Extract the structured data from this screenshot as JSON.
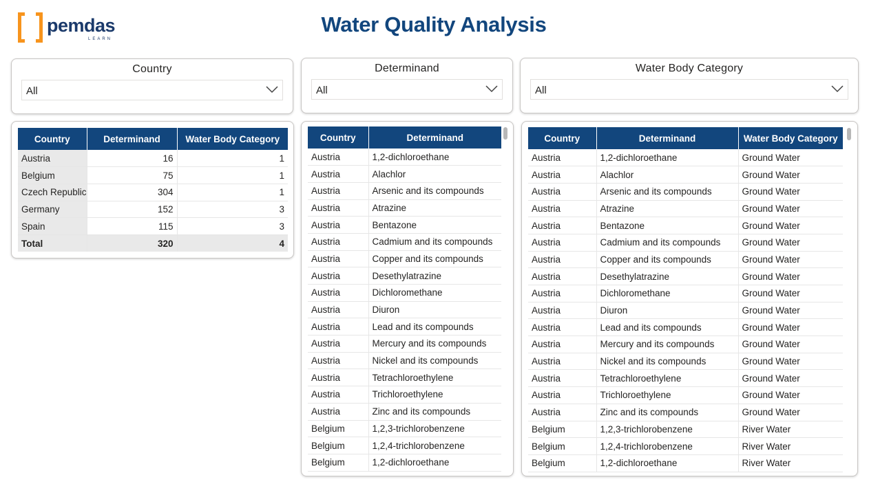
{
  "logo": {
    "word": "pemdas",
    "sub": "LEARN"
  },
  "title": "Water Quality Analysis",
  "slicers": {
    "country": {
      "title": "Country",
      "value": "All"
    },
    "determinand": {
      "title": "Determinand",
      "value": "All"
    },
    "water_body": {
      "title": "Water Body Category",
      "value": "All"
    }
  },
  "summary_table": {
    "headers": [
      "Country",
      "Determinand",
      "Water Body Category"
    ],
    "rows": [
      [
        "Austria",
        "16",
        "1"
      ],
      [
        "Belgium",
        "75",
        "1"
      ],
      [
        "Czech Republic",
        "304",
        "1"
      ],
      [
        "Germany",
        "152",
        "3"
      ],
      [
        "Spain",
        "115",
        "3"
      ]
    ],
    "total": [
      "Total",
      "320",
      "4"
    ]
  },
  "determinand_table": {
    "headers": [
      "Country",
      "Determinand"
    ],
    "rows": [
      [
        "Austria",
        "1,2-dichloroethane"
      ],
      [
        "Austria",
        "Alachlor"
      ],
      [
        "Austria",
        "Arsenic and its compounds"
      ],
      [
        "Austria",
        "Atrazine"
      ],
      [
        "Austria",
        "Bentazone"
      ],
      [
        "Austria",
        "Cadmium and its compounds"
      ],
      [
        "Austria",
        "Copper and its compounds"
      ],
      [
        "Austria",
        "Desethylatrazine"
      ],
      [
        "Austria",
        "Dichloromethane"
      ],
      [
        "Austria",
        "Diuron"
      ],
      [
        "Austria",
        "Lead and its compounds"
      ],
      [
        "Austria",
        "Mercury and its compounds"
      ],
      [
        "Austria",
        "Nickel and its compounds"
      ],
      [
        "Austria",
        "Tetrachloroethylene"
      ],
      [
        "Austria",
        "Trichloroethylene"
      ],
      [
        "Austria",
        "Zinc and its compounds"
      ],
      [
        "Belgium",
        "1,2,3-trichlorobenzene"
      ],
      [
        "Belgium",
        "1,2,4-trichlorobenzene"
      ],
      [
        "Belgium",
        "1,2-dichloroethane"
      ]
    ]
  },
  "detail_table": {
    "headers": [
      "Country",
      "Determinand",
      "Water Body Category"
    ],
    "rows": [
      [
        "Austria",
        "1,2-dichloroethane",
        "Ground Water"
      ],
      [
        "Austria",
        "Alachlor",
        "Ground Water"
      ],
      [
        "Austria",
        "Arsenic and its compounds",
        "Ground Water"
      ],
      [
        "Austria",
        "Atrazine",
        "Ground Water"
      ],
      [
        "Austria",
        "Bentazone",
        "Ground Water"
      ],
      [
        "Austria",
        "Cadmium and its compounds",
        "Ground Water"
      ],
      [
        "Austria",
        "Copper and its compounds",
        "Ground Water"
      ],
      [
        "Austria",
        "Desethylatrazine",
        "Ground Water"
      ],
      [
        "Austria",
        "Dichloromethane",
        "Ground Water"
      ],
      [
        "Austria",
        "Diuron",
        "Ground Water"
      ],
      [
        "Austria",
        "Lead and its compounds",
        "Ground Water"
      ],
      [
        "Austria",
        "Mercury and its compounds",
        "Ground Water"
      ],
      [
        "Austria",
        "Nickel and its compounds",
        "Ground Water"
      ],
      [
        "Austria",
        "Tetrachloroethylene",
        "Ground Water"
      ],
      [
        "Austria",
        "Trichloroethylene",
        "Ground Water"
      ],
      [
        "Austria",
        "Zinc and its compounds",
        "Ground Water"
      ],
      [
        "Belgium",
        "1,2,3-trichlorobenzene",
        "River Water"
      ],
      [
        "Belgium",
        "1,2,4-trichlorobenzene",
        "River Water"
      ],
      [
        "Belgium",
        "1,2-dichloroethane",
        "River Water"
      ]
    ]
  },
  "colors": {
    "header_bg": "#12467d",
    "title": "#12467d",
    "logo_bracket": "#f7941d",
    "logo_text": "#1b3a6b"
  }
}
